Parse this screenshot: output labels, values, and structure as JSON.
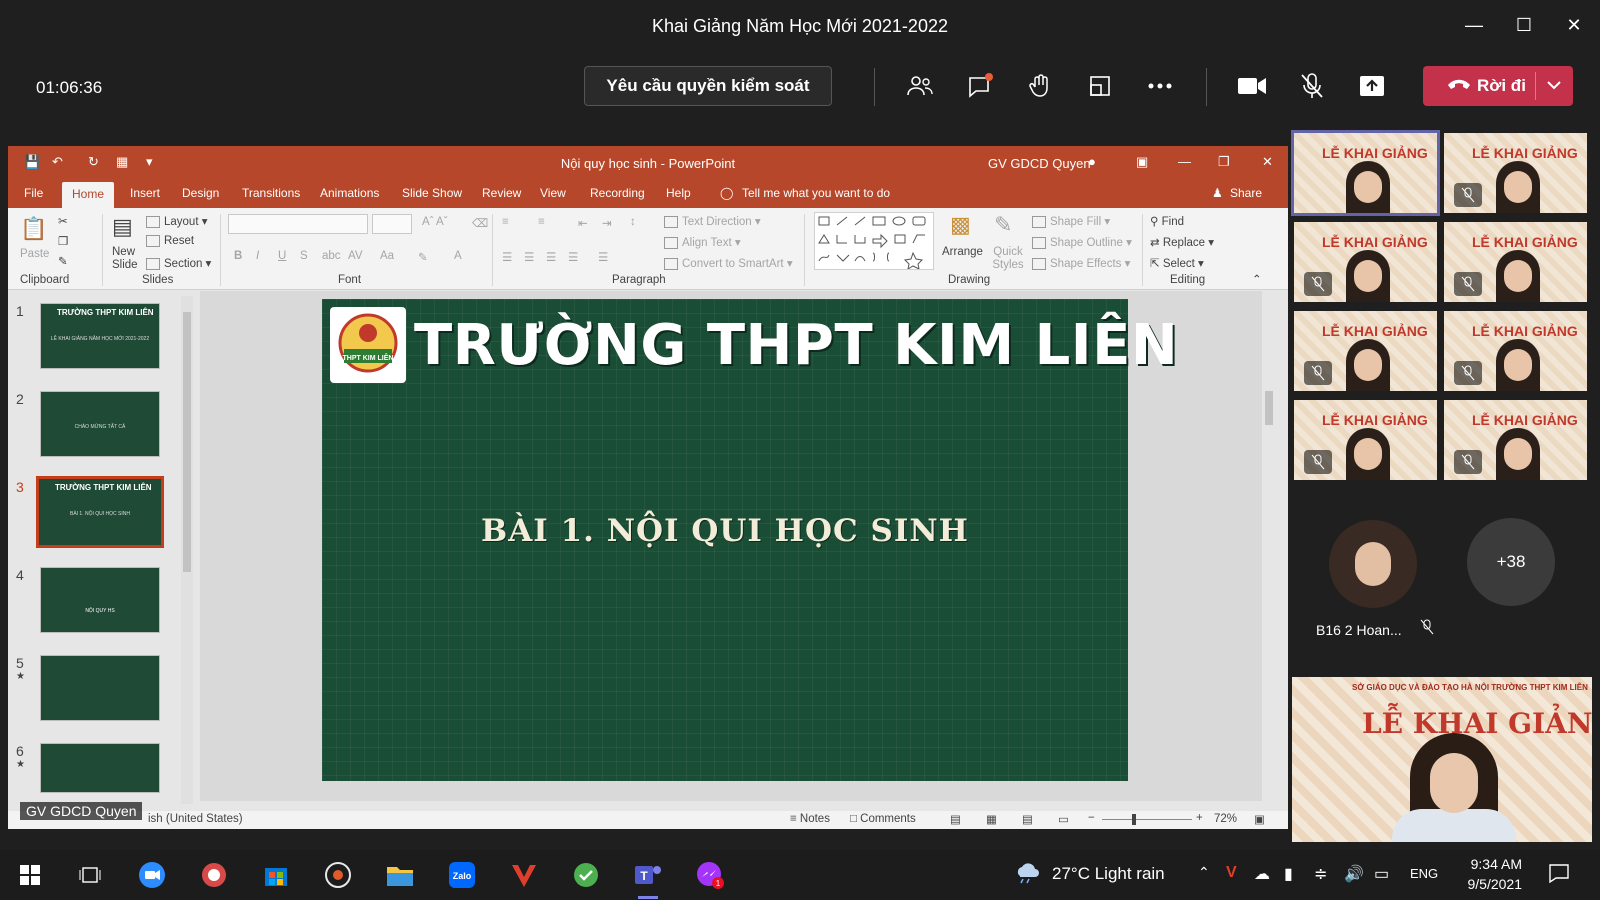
{
  "window": {
    "title": "Khai Giảng Năm Học Mới 2021-2022"
  },
  "meeting": {
    "timer": "01:06:36",
    "request_control_label": "Yêu cầu quyền kiểm soát",
    "leave_label": "Rời đi",
    "toolbar_icons": [
      "people-icon",
      "chat-icon",
      "reactions-icon",
      "rooms-icon",
      "more-icon",
      "camera-icon",
      "mic-off-icon",
      "share-icon"
    ],
    "leave_color": "#c4314b"
  },
  "ppt": {
    "doc_title": "Nội quy học sinh  -  PowerPoint",
    "user": "GV GDCD Quyen",
    "tabs": [
      "File",
      "Home",
      "Insert",
      "Design",
      "Transitions",
      "Animations",
      "Slide Show",
      "Review",
      "View",
      "Recording",
      "Help"
    ],
    "active_tab": "Home",
    "tell_me": "Tell me what you want to do",
    "share": "Share",
    "ribbon": {
      "clipboard": {
        "label": "Clipboard",
        "paste": "Paste"
      },
      "slides": {
        "label": "Slides",
        "new_slide": "New Slide",
        "layout": "Layout",
        "reset": "Reset",
        "section": "Section"
      },
      "font": {
        "label": "Font"
      },
      "paragraph": {
        "label": "Paragraph",
        "text_direction": "Text Direction",
        "align_text": "Align Text",
        "convert_smartart": "Convert to SmartArt"
      },
      "drawing": {
        "label": "Drawing",
        "arrange": "Arrange",
        "quick_styles": "Quick Styles",
        "shape_fill": "Shape Fill",
        "shape_outline": "Shape Outline",
        "shape_effects": "Shape Effects"
      },
      "editing": {
        "label": "Editing",
        "find": "Find",
        "replace": "Replace",
        "select": "Select"
      }
    },
    "accent": "#b7472a",
    "thumbnails": [
      {
        "num": "1",
        "title": "TRƯỜNG THPT KIM LIÊN",
        "sub": "LỄ KHAI GIẢNG NĂM HỌC MỚI 2021-2022",
        "star": false
      },
      {
        "num": "2",
        "title": "",
        "sub": "CHÀO MỪNG TẤT CẢ",
        "star": false
      },
      {
        "num": "3",
        "title": "TRƯỜNG THPT KIM LIÊN",
        "sub": "BÀI 1. NỘI QUI HỌC SINH",
        "star": false
      },
      {
        "num": "4",
        "title": "",
        "sub": "NỘI QUY HS",
        "star": false
      },
      {
        "num": "5",
        "title": "",
        "sub": "",
        "star": true
      },
      {
        "num": "6",
        "title": "",
        "sub": "",
        "star": true
      }
    ],
    "selected_slide": "3",
    "slide": {
      "title": "TRƯỜNG THPT KIM LIÊN",
      "logo_text": "THPT KIM LIÊN",
      "subtitle": "BÀI 1. NỘI QUI HỌC SINH"
    },
    "status": {
      "language": "ish (United States)",
      "notes": "Notes",
      "comments": "Comments",
      "zoom": "72%"
    },
    "presenter_label": "GV GDCD Quyen"
  },
  "participants": {
    "tile_banner": "LỄ KHAI GIẢNG",
    "named": {
      "name": "B16 2 Hoan..."
    },
    "overflow_count": "+38",
    "big_tile": {
      "line1": "SỞ GIÁO DỤC VÀ ĐÀO TẠO HÀ NỘI  TRƯỜNG THPT KIM LIÊN",
      "line2": "LỄ KHAI GIẢNG"
    }
  },
  "taskbar": {
    "weather": "27°C  Light rain",
    "lang": "ENG",
    "time": "9:34 AM",
    "date": "9/5/2021"
  }
}
